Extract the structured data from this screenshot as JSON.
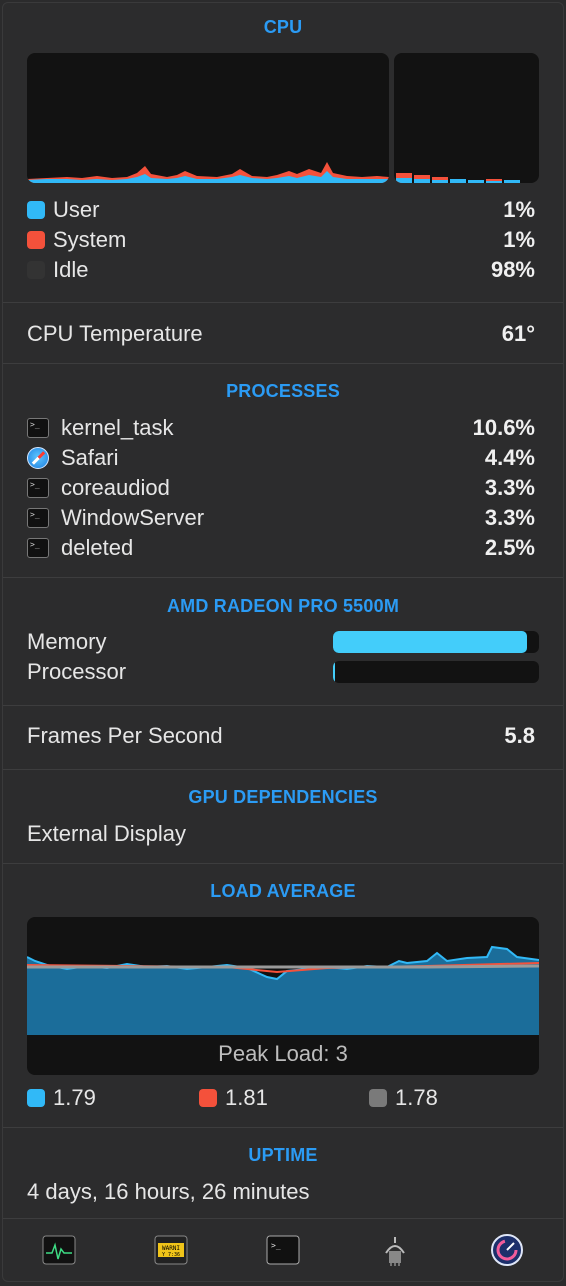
{
  "cpu": {
    "title": "CPU",
    "legend": [
      {
        "label": "User",
        "value": "1%",
        "color": "#31b9f7"
      },
      {
        "label": "System",
        "value": "1%",
        "color": "#f4513b"
      },
      {
        "label": "Idle",
        "value": "98%",
        "color": "#333333"
      }
    ]
  },
  "temperature": {
    "label": "CPU Temperature",
    "value": "61°"
  },
  "processes": {
    "title": "PROCESSES",
    "items": [
      {
        "name": "kernel_task",
        "value": "10.6%",
        "icon": "terminal-icon"
      },
      {
        "name": "Safari",
        "value": "4.4%",
        "icon": "safari-icon"
      },
      {
        "name": "coreaudiod",
        "value": "3.3%",
        "icon": "terminal-icon"
      },
      {
        "name": "WindowServer",
        "value": "3.3%",
        "icon": "terminal-icon"
      },
      {
        "name": "deleted",
        "value": "2.5%",
        "icon": "terminal-icon"
      }
    ]
  },
  "gpu": {
    "title": "AMD RADEON PRO 5500M",
    "memory_label": "Memory",
    "memory_fraction": 0.94,
    "processor_label": "Processor",
    "processor_fraction": 0.01
  },
  "fps": {
    "label": "Frames Per Second",
    "value": "5.8"
  },
  "gpu_dependencies": {
    "title": "GPU DEPENDENCIES",
    "item": "External Display"
  },
  "load_average": {
    "title": "LOAD AVERAGE",
    "peak_label": "Peak Load: 3",
    "values": [
      {
        "value": "1.79",
        "color": "#31b9f7"
      },
      {
        "value": "1.81",
        "color": "#f4513b"
      },
      {
        "value": "1.78",
        "color": "#7a7a7a"
      }
    ]
  },
  "uptime": {
    "title": "UPTIME",
    "value": "4 days, 16 hours, 26 minutes"
  },
  "toolbar": {
    "icons": [
      "activity-monitor-icon",
      "console-icon",
      "terminal-icon",
      "system-information-icon",
      "istat-icon"
    ]
  }
}
